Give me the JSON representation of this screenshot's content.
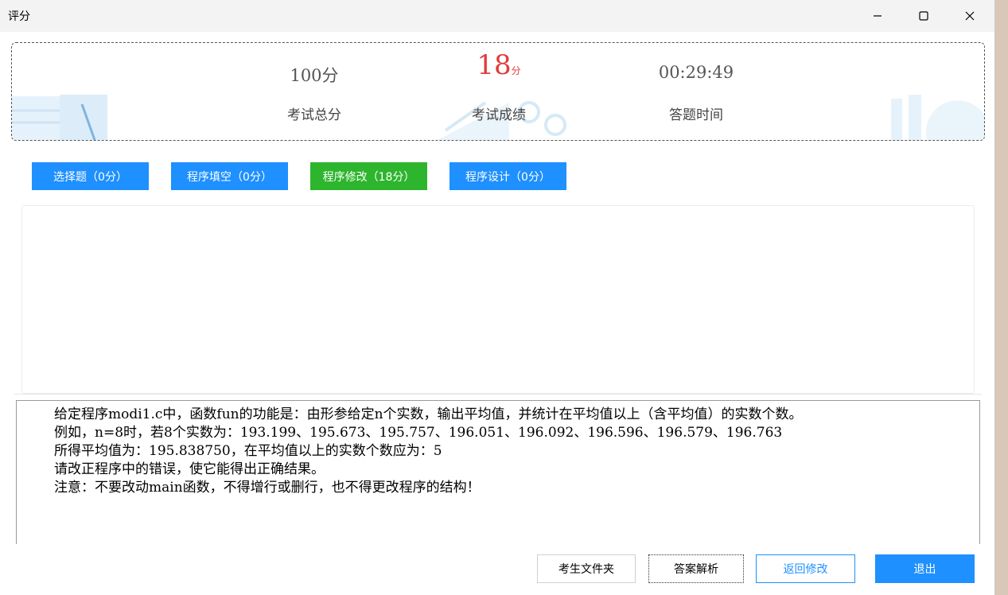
{
  "window": {
    "title": "评分",
    "controls": [
      "minimize-icon",
      "maximize-icon",
      "close-icon"
    ]
  },
  "score": {
    "total_value": "100分",
    "total_label": "考试总分",
    "result_value": "18",
    "result_unit": "分",
    "result_label": "考试成绩",
    "time_value": "00:29:49",
    "time_label": "答题时间"
  },
  "tabs": [
    {
      "label": "选择题（0分）",
      "active": false
    },
    {
      "label": "程序填空（0分）",
      "active": false
    },
    {
      "label": "程序修改（18分）",
      "active": true
    },
    {
      "label": "程序设计（0分）",
      "active": false
    }
  ],
  "question": {
    "lines": [
      "给定程序modi1.c中，函数fun的功能是：由形参给定n个实数，输出平均值，并统计在平均值以上（含平均值）的实数个数。",
      "例如，n=8时，若8个实数为：193.199、195.673、195.757、196.051、196.092、196.596、196.579、196.763",
      "所得平均值为：195.838750，在平均值以上的实数个数应为：5",
      "请改正程序中的错误，使它能得出正确结果。",
      "注意：不要改动main函数，不得增行或删行，也不得更改程序的结构！"
    ]
  },
  "buttons": {
    "student_folder": "考生文件夹",
    "answer_analysis": "答案解析",
    "back_to_edit": "返回修改",
    "exit": "退出"
  },
  "colors": {
    "accent_blue": "#1e90ff",
    "active_green": "#2db52d",
    "score_red": "#e23b3b"
  }
}
